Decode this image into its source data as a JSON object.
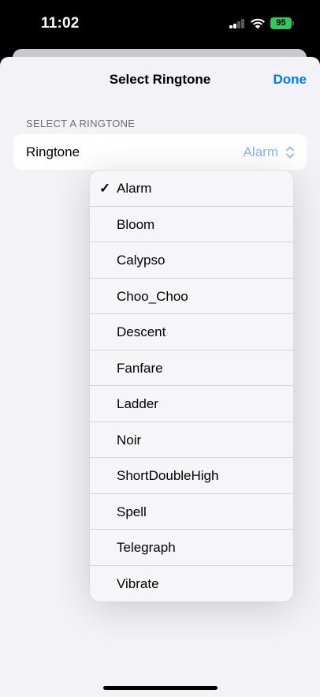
{
  "status_bar": {
    "time": "11:02",
    "battery_percent": "95",
    "battery_color": "#34c759",
    "signal_bars_active": 2,
    "signal_bars_total": 4
  },
  "nav": {
    "title": "Select Ringtone",
    "done_label": "Done",
    "accent_color": "#007aff"
  },
  "section": {
    "header": "SELECT A RINGTONE"
  },
  "ringtone_row": {
    "label": "Ringtone",
    "value": "Alarm"
  },
  "menu": {
    "selected": "Alarm",
    "items": [
      {
        "label": "Alarm",
        "checked": true
      },
      {
        "label": "Bloom",
        "checked": false
      },
      {
        "label": "Calypso",
        "checked": false
      },
      {
        "label": "Choo_Choo",
        "checked": false
      },
      {
        "label": "Descent",
        "checked": false
      },
      {
        "label": "Fanfare",
        "checked": false
      },
      {
        "label": "Ladder",
        "checked": false
      },
      {
        "label": "Noir",
        "checked": false
      },
      {
        "label": "ShortDoubleHigh",
        "checked": false
      },
      {
        "label": "Spell",
        "checked": false
      },
      {
        "label": "Telegraph",
        "checked": false
      },
      {
        "label": "Vibrate",
        "checked": false
      }
    ]
  }
}
